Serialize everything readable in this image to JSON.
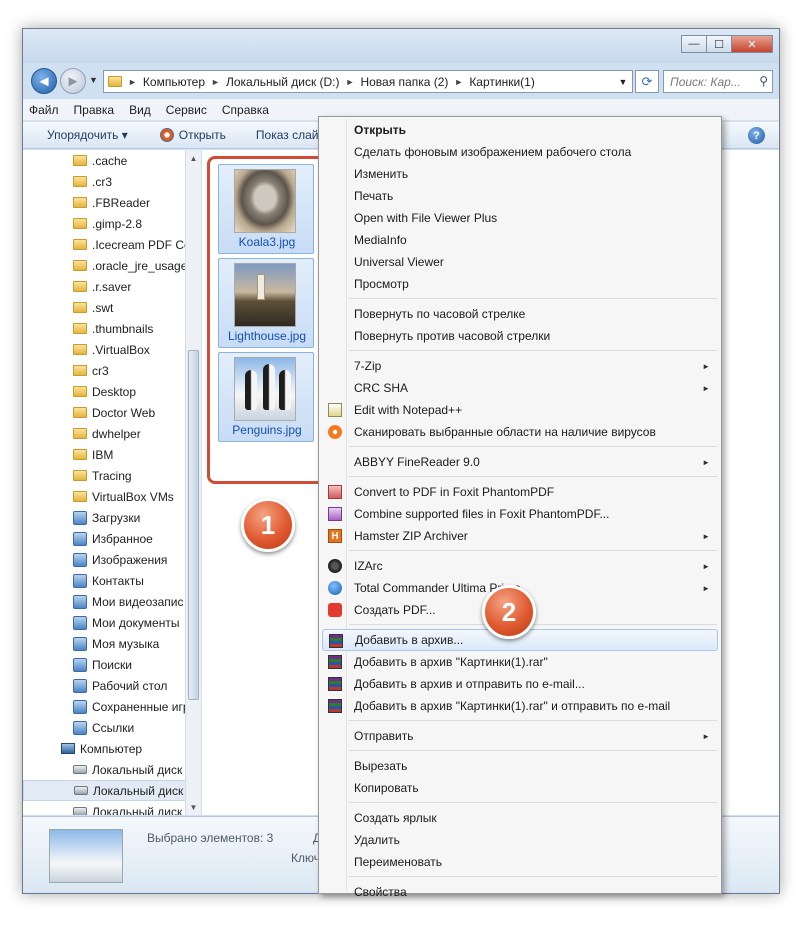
{
  "window": {
    "controls": {
      "minimize": "—",
      "maximize": "☐",
      "close": "✕"
    }
  },
  "nav": {
    "back": "◄",
    "forward": "►",
    "breadcrumbs": [
      "Компьютер",
      "Локальный диск (D:)",
      "Новая папка (2)",
      "Картинки(1)"
    ],
    "search_placeholder": "Поиск: Кар..."
  },
  "menubar": [
    "Файл",
    "Правка",
    "Вид",
    "Сервис",
    "Справка"
  ],
  "toolbar": {
    "organize": "Упорядочить ▾",
    "open": "Открыть",
    "slideshow": "Показ слай"
  },
  "navpane": {
    "items": [
      {
        "label": ".cache",
        "icon": "folder"
      },
      {
        "label": ".cr3",
        "icon": "folder"
      },
      {
        "label": ".FBReader",
        "icon": "folder"
      },
      {
        "label": ".gimp-2.8",
        "icon": "folder"
      },
      {
        "label": ".Icecream PDF Co",
        "icon": "folder"
      },
      {
        "label": ".oracle_jre_usage",
        "icon": "folder"
      },
      {
        "label": ".r.saver",
        "icon": "folder"
      },
      {
        "label": ".swt",
        "icon": "folder"
      },
      {
        "label": ".thumbnails",
        "icon": "folder"
      },
      {
        "label": ".VirtualBox",
        "icon": "folder"
      },
      {
        "label": "cr3",
        "icon": "folder"
      },
      {
        "label": "Desktop",
        "icon": "folder"
      },
      {
        "label": "Doctor Web",
        "icon": "folder"
      },
      {
        "label": "dwhelper",
        "icon": "folder"
      },
      {
        "label": "IBM",
        "icon": "folder"
      },
      {
        "label": "Tracing",
        "icon": "folder"
      },
      {
        "label": "VirtualBox VMs",
        "icon": "folder"
      },
      {
        "label": "Загрузки",
        "icon": "special"
      },
      {
        "label": "Избранное",
        "icon": "special"
      },
      {
        "label": "Изображения",
        "icon": "special"
      },
      {
        "label": "Контакты",
        "icon": "special"
      },
      {
        "label": "Мои видеозапис",
        "icon": "special"
      },
      {
        "label": "Мои документы",
        "icon": "special"
      },
      {
        "label": "Моя музыка",
        "icon": "special"
      },
      {
        "label": "Поиски",
        "icon": "special"
      },
      {
        "label": "Рабочий стол",
        "icon": "special"
      },
      {
        "label": "Сохраненные игр",
        "icon": "special"
      },
      {
        "label": "Ссылки",
        "icon": "special"
      },
      {
        "label": "Компьютер",
        "icon": "pc"
      },
      {
        "label": "Локальный диск",
        "icon": "disk"
      },
      {
        "label": "Локальный диск",
        "icon": "disk",
        "selected": true
      },
      {
        "label": "Локальный диск",
        "icon": "disk"
      }
    ]
  },
  "files": [
    {
      "name": "Koala3.jpg",
      "thumb": "koala"
    },
    {
      "name": "Lighthouse.jpg",
      "thumb": "lighthouse"
    },
    {
      "name": "Penguins.jpg",
      "thumb": "penguins"
    }
  ],
  "details": {
    "selected": "Выбрано элементов: 3",
    "d": "Д",
    "k": "Ключ"
  },
  "context_menu": {
    "groups": [
      [
        {
          "label": "Открыть",
          "bold": true
        },
        {
          "label": "Сделать фоновым изображением рабочего стола"
        },
        {
          "label": "Изменить"
        },
        {
          "label": "Печать"
        },
        {
          "label": "Open with File Viewer Plus"
        },
        {
          "label": "MediaInfo"
        },
        {
          "label": "Universal Viewer"
        },
        {
          "label": "Просмотр"
        }
      ],
      [
        {
          "label": "Повернуть по часовой стрелке"
        },
        {
          "label": "Повернуть против часовой стрелки"
        }
      ],
      [
        {
          "label": "7-Zip",
          "submenu": true
        },
        {
          "label": "CRC SHA",
          "submenu": true
        },
        {
          "label": "Edit with Notepad++",
          "icon": "notepad"
        },
        {
          "label": "Сканировать выбранные области на наличие вирусов",
          "icon": "avast"
        }
      ],
      [
        {
          "label": "ABBYY FineReader 9.0",
          "submenu": true
        }
      ],
      [
        {
          "label": "Convert to PDF in Foxit PhantomPDF",
          "icon": "foxit"
        },
        {
          "label": "Combine supported files in Foxit PhantomPDF...",
          "icon": "foxit2"
        },
        {
          "label": "Hamster ZIP Archiver",
          "icon": "hamster",
          "submenu": true
        }
      ],
      [
        {
          "label": "IZArc",
          "icon": "izarc",
          "submenu": true
        },
        {
          "label": "Total Commander Ultima Prime",
          "icon": "tc",
          "submenu": true
        },
        {
          "label": "Создать PDF...",
          "icon": "pdf"
        }
      ],
      [
        {
          "label": "Добавить в архив...",
          "icon": "rar",
          "highlighted": true
        },
        {
          "label": "Добавить в архив \"Картинки(1).rar\"",
          "icon": "rar"
        },
        {
          "label": "Добавить в архив и отправить по e-mail...",
          "icon": "rar"
        },
        {
          "label": "Добавить в архив \"Картинки(1).rar\" и отправить по e-mail",
          "icon": "rar"
        }
      ],
      [
        {
          "label": "Отправить",
          "submenu": true
        }
      ],
      [
        {
          "label": "Вырезать"
        },
        {
          "label": "Копировать"
        }
      ],
      [
        {
          "label": "Создать ярлык"
        },
        {
          "label": "Удалить"
        },
        {
          "label": "Переименовать"
        }
      ],
      [
        {
          "label": "Свойства"
        }
      ]
    ]
  },
  "annotations": {
    "badge1": "1",
    "badge2": "2"
  }
}
